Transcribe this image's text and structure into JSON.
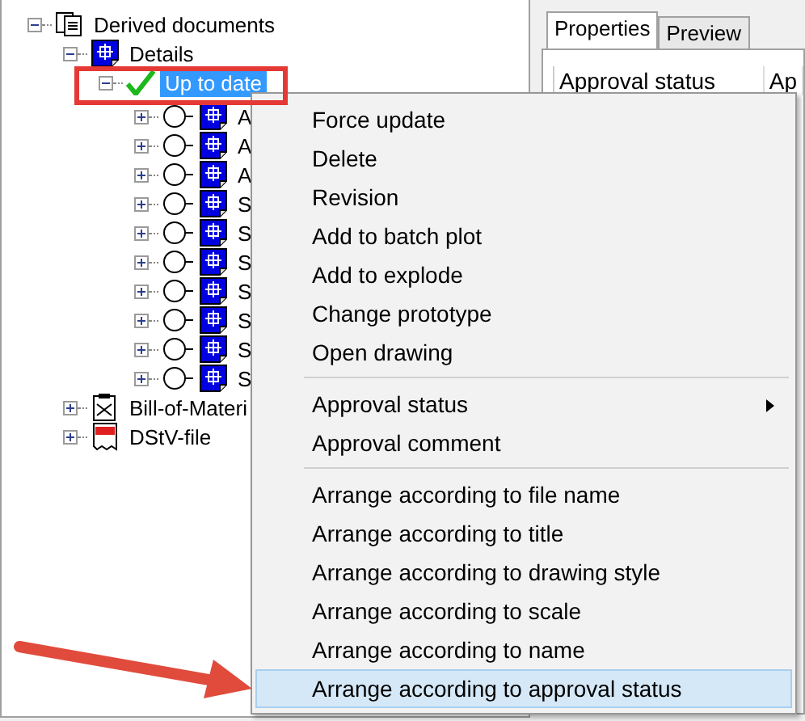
{
  "tree": [
    {
      "label": "Derived documents",
      "kind": "documents",
      "expanded": true,
      "selected": false,
      "children": [
        {
          "label": "Details",
          "kind": "drawing",
          "expanded": true,
          "selected": false,
          "children": [
            {
              "label": "Up to date",
              "kind": "check",
              "expanded": true,
              "selected": true,
              "children": [
                {
                  "label": "A",
                  "kind": "status-drawing",
                  "expanded": false,
                  "selected": false
                },
                {
                  "label": "A",
                  "kind": "status-drawing",
                  "expanded": false,
                  "selected": false
                },
                {
                  "label": "A",
                  "kind": "status-drawing",
                  "expanded": false,
                  "selected": false
                },
                {
                  "label": "S",
                  "kind": "status-drawing",
                  "expanded": false,
                  "selected": false
                },
                {
                  "label": "S",
                  "kind": "status-drawing",
                  "expanded": false,
                  "selected": false
                },
                {
                  "label": "S",
                  "kind": "status-drawing",
                  "expanded": false,
                  "selected": false
                },
                {
                  "label": "S",
                  "kind": "status-drawing",
                  "expanded": false,
                  "selected": false
                },
                {
                  "label": "S",
                  "kind": "status-drawing",
                  "expanded": false,
                  "selected": false
                },
                {
                  "label": "S",
                  "kind": "status-drawing",
                  "expanded": false,
                  "selected": false
                },
                {
                  "label": "S",
                  "kind": "status-drawing",
                  "expanded": false,
                  "selected": false
                }
              ]
            }
          ]
        },
        {
          "label": "Bill-of-Materi",
          "kind": "bom",
          "expanded": false,
          "selected": false
        },
        {
          "label": "DStV-file",
          "kind": "dstv",
          "expanded": false,
          "selected": false
        }
      ]
    }
  ],
  "tabs": [
    {
      "label": "Properties",
      "selected": true
    },
    {
      "label": "Preview",
      "selected": false
    }
  ],
  "columns": [
    "Approval status",
    "Ap"
  ],
  "menu": [
    [
      {
        "label": "Force update",
        "submenu": false,
        "selected": false
      },
      {
        "label": "Delete",
        "submenu": false,
        "selected": false
      },
      {
        "label": "Revision",
        "submenu": false,
        "selected": false
      },
      {
        "label": "Add to batch plot",
        "submenu": false,
        "selected": false
      },
      {
        "label": "Add to explode",
        "submenu": false,
        "selected": false
      },
      {
        "label": "Change prototype",
        "submenu": false,
        "selected": false
      },
      {
        "label": "Open drawing",
        "submenu": false,
        "selected": false
      }
    ],
    [
      {
        "label": "Approval status",
        "submenu": true,
        "selected": false
      },
      {
        "label": "Approval comment",
        "submenu": false,
        "selected": false
      }
    ],
    [
      {
        "label": "Arrange according to file name",
        "submenu": false,
        "selected": false
      },
      {
        "label": "Arrange according to title",
        "submenu": false,
        "selected": false
      },
      {
        "label": "Arrange according to drawing style",
        "submenu": false,
        "selected": false
      },
      {
        "label": "Arrange according to scale",
        "submenu": false,
        "selected": false
      },
      {
        "label": "Arrange according to name",
        "submenu": false,
        "selected": false
      },
      {
        "label": "Arrange according to approval status",
        "submenu": false,
        "selected": true
      }
    ]
  ],
  "annotations": {
    "highlight_box": true,
    "arrow": true
  }
}
